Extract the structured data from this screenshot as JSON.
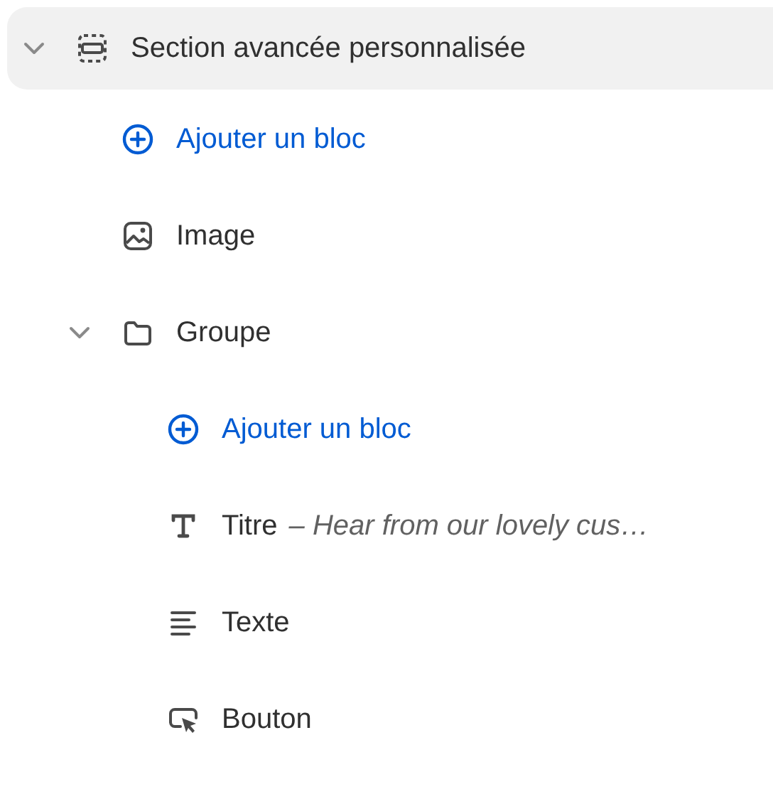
{
  "tree": {
    "items": [
      {
        "kind": "section",
        "label": "Section avancée personnalisée",
        "selected": true,
        "expanded": true,
        "children": [
          {
            "kind": "add",
            "label": "Ajouter un bloc",
            "selected": false
          },
          {
            "kind": "image",
            "label": "Image",
            "selected": false
          },
          {
            "kind": "group",
            "label": "Groupe",
            "selected": false,
            "expanded": true,
            "children": [
              {
                "kind": "add",
                "label": "Ajouter un bloc",
                "selected": false
              },
              {
                "kind": "heading",
                "label": "Titre",
                "detail": "– Hear from our lovely cus…",
                "selected": false
              },
              {
                "kind": "text",
                "label": "Texte",
                "selected": false
              },
              {
                "kind": "button",
                "label": "Bouton",
                "selected": false
              }
            ]
          }
        ]
      }
    ]
  }
}
